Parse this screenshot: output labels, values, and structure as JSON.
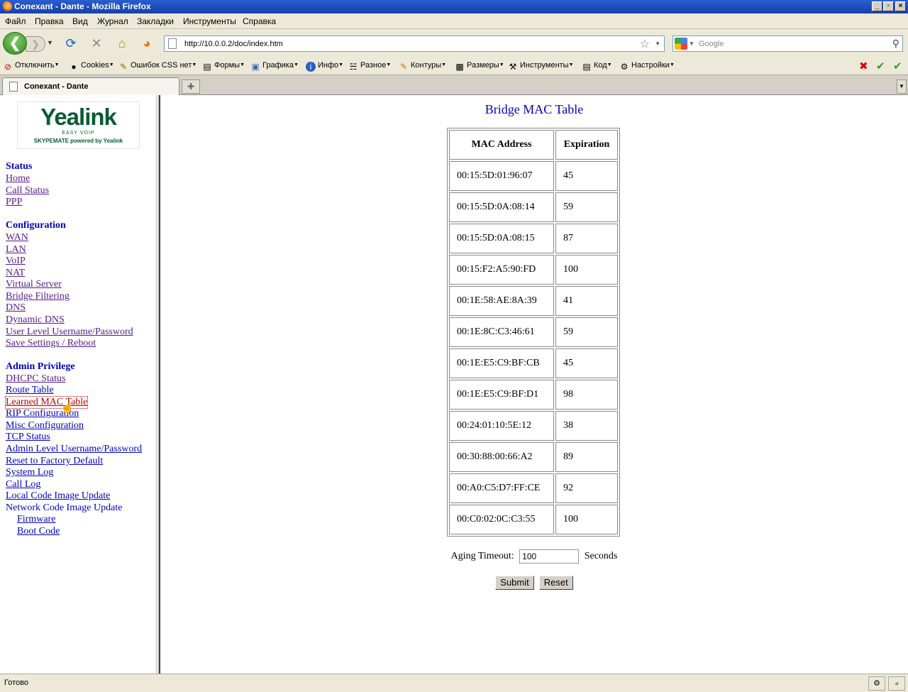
{
  "window": {
    "title": "Conexant - Dante - Mozilla Firefox",
    "min": "_",
    "max": "▫",
    "close": "×"
  },
  "menu": [
    "Файл",
    "Правка",
    "Вид",
    "Журнал",
    "Закладки",
    "Инструменты",
    "Справка"
  ],
  "nav": {
    "url": "http://10.0.0.2/doc/index.htm",
    "search_placeholder": "Google"
  },
  "toolbar": [
    {
      "label": "Отключить",
      "icon": "no-entry-icon"
    },
    {
      "label": "Cookies",
      "icon": "person-icon"
    },
    {
      "label": "Ошибок CSS нет",
      "icon": "pencil-icon"
    },
    {
      "label": "Формы",
      "icon": "form-icon"
    },
    {
      "label": "Графика",
      "icon": "image-icon"
    },
    {
      "label": "Инфо",
      "icon": "info-icon"
    },
    {
      "label": "Разное",
      "icon": "misc-icon"
    },
    {
      "label": "Контуры",
      "icon": "outline-icon"
    },
    {
      "label": "Размеры",
      "icon": "resize-icon"
    },
    {
      "label": "Инструменты",
      "icon": "tools-icon"
    },
    {
      "label": "Код",
      "icon": "code-icon"
    },
    {
      "label": "Настройки",
      "icon": "settings-icon"
    }
  ],
  "tab": {
    "label": "Conexant - Dante"
  },
  "logo": {
    "brand": "Yealink",
    "sub": "EASY VOIP",
    "sub2": "SKYPEMATE powered by Yealink"
  },
  "sidebar": {
    "status_title": "Status",
    "status_links": [
      "Home",
      "Call Status",
      "PPP"
    ],
    "config_title": "Configuration",
    "config_links": [
      "WAN",
      "LAN",
      "VoIP",
      "NAT",
      "Virtual Server",
      "Bridge Filtering",
      "DNS",
      "Dynamic DNS",
      "User Level Username/Password",
      "Save Settings / Reboot"
    ],
    "admin_title": "Admin Privilege",
    "admin_links": [
      "DHCPC Status",
      "Route Table",
      "Learned MAC Table",
      "RIP Configuration",
      "Misc Configuration",
      "TCP Status",
      "Admin Level Username/Password",
      "Reset to Factory Default",
      "System Log",
      "Call Log",
      "Local Code Image Update"
    ],
    "network_label": "Network Code Image Update",
    "network_sub": [
      "Firmware",
      "Boot Code"
    ]
  },
  "main": {
    "title": "Bridge MAC Table",
    "headers": [
      "MAC Address",
      "Expiration"
    ],
    "rows": [
      [
        "00:15:5D:01:96:07",
        "45"
      ],
      [
        "00:15:5D:0A:08:14",
        "59"
      ],
      [
        "00:15:5D:0A:08:15",
        "87"
      ],
      [
        "00:15:F2:A5:90:FD",
        "100"
      ],
      [
        "00:1E:58:AE:8A:39",
        "41"
      ],
      [
        "00:1E:8C:C3:46:61",
        "59"
      ],
      [
        "00:1E:E5:C9:BF:CB",
        "45"
      ],
      [
        "00:1E:E5:C9:BF:D1",
        "98"
      ],
      [
        "00:24:01:10:5E:12",
        "38"
      ],
      [
        "00:30:88:00:66:A2",
        "89"
      ],
      [
        "00:A0:C5:D7:FF:CE",
        "92"
      ],
      [
        "00:C0:02:0C:C3:55",
        "100"
      ]
    ],
    "aging_label": "Aging Timeout:",
    "aging_value": "100",
    "aging_unit": "Seconds",
    "submit": "Submit",
    "reset": "Reset"
  },
  "status_text": "Готово"
}
